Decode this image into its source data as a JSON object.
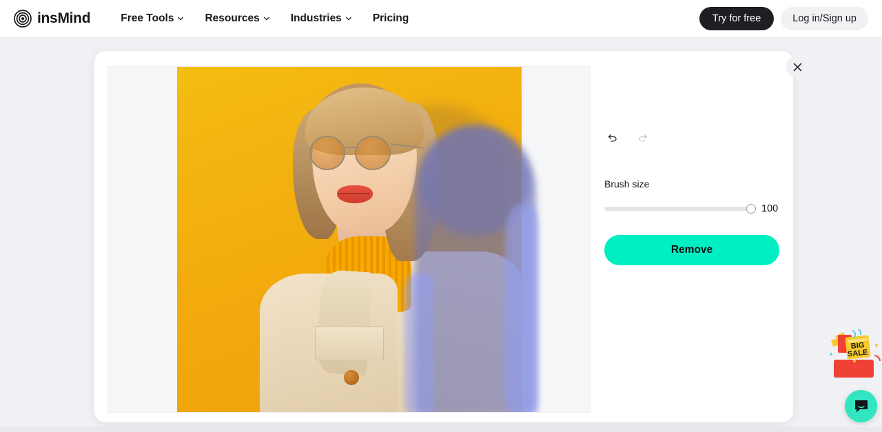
{
  "header": {
    "logo": {
      "text": "insMind",
      "icon": "concentric-circles-logo"
    },
    "nav": [
      {
        "label": "Free Tools",
        "icon": "chevron-down-icon",
        "has_dropdown": true
      },
      {
        "label": "Resources",
        "icon": "chevron-down-icon",
        "has_dropdown": true
      },
      {
        "label": "Industries",
        "icon": "chevron-down-icon",
        "has_dropdown": true
      },
      {
        "label": "Pricing",
        "has_dropdown": false
      }
    ],
    "try_label": "Try for free",
    "login_label": "Log in/Sign up"
  },
  "editor": {
    "close_icon": "close-icon",
    "canvas": {
      "background": "#f5f6f8",
      "photo_alt": "Blonde woman with round tinted sunglasses in cream coat and yellow turtleneck on yellow background",
      "photo_bg_color": "#f2ab0d",
      "mask_color": "#6f74b5",
      "mask_spill_color": "#8f9cf2"
    },
    "zoom_toolbar": {
      "zoom_out_icon": "minus-icon",
      "zoom_in_icon": "plus-icon",
      "pan_icon": "hand-icon"
    },
    "panel": {
      "undo_icon": "undo-icon",
      "redo_icon": "redo-icon",
      "undo_enabled": true,
      "redo_enabled": false,
      "brush_label": "Brush size",
      "brush_value": "100",
      "brush_min": "0",
      "brush_max": "100",
      "remove_label": "Remove",
      "remove_color": "#00efc2"
    }
  },
  "widgets": {
    "sale_badge": {
      "line1": "BIG",
      "line2": "SALE",
      "icon": "gift-box-icon"
    },
    "chat": {
      "icon": "chat-bubble-icon",
      "color": "#31e6c0"
    }
  }
}
